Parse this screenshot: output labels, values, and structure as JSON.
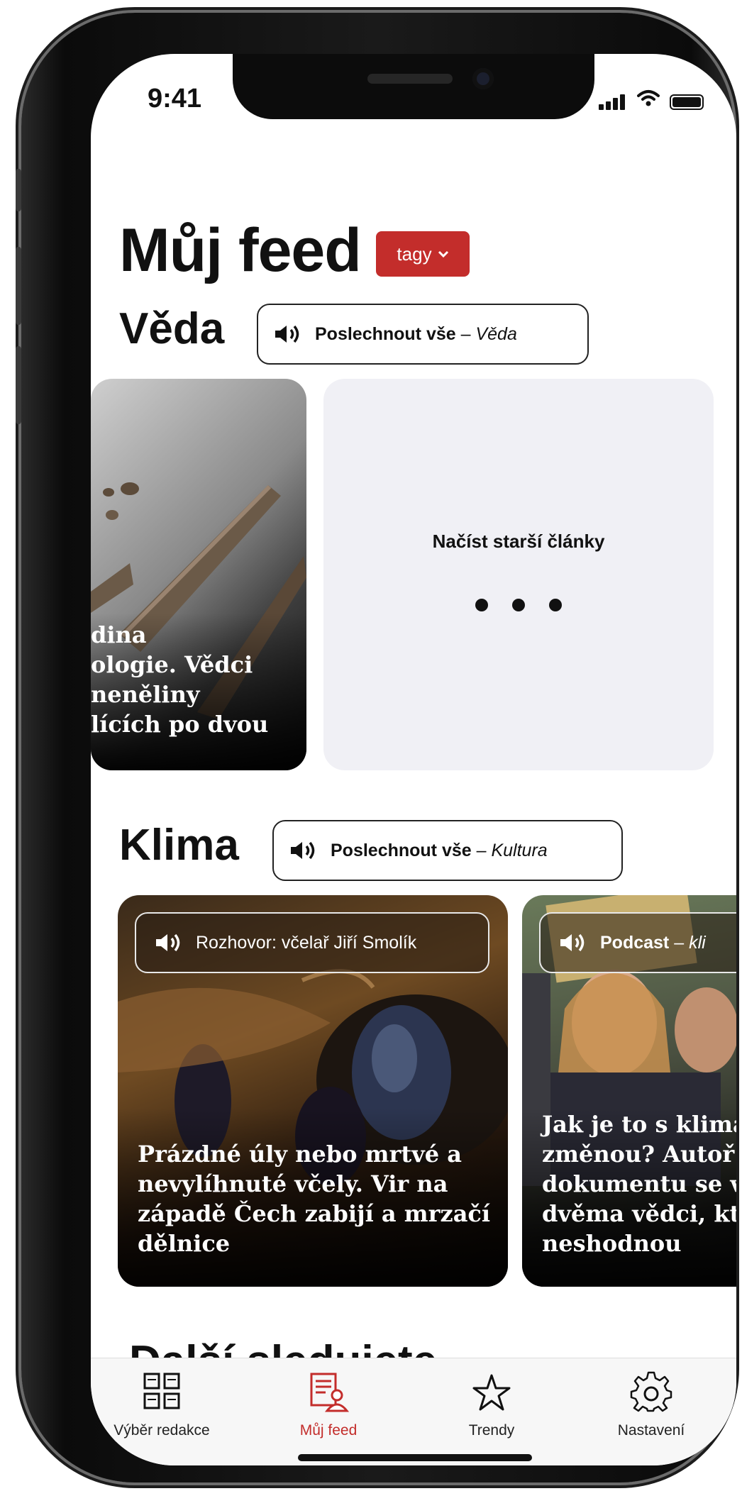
{
  "status_bar": {
    "time": "9:41"
  },
  "header": {
    "title": "Můj feed",
    "tags_button": "tagy"
  },
  "sections": [
    {
      "title": "Věda",
      "listen": {
        "label": "Poslechnout vše",
        "separator": " – ",
        "topic": "Věda"
      },
      "cards": [
        {
          "title_lines": [
            "dina",
            "ologie. Vědci",
            "neněliny",
            "lících po dvou"
          ]
        }
      ],
      "load_more": {
        "label": "Načíst starší články"
      }
    },
    {
      "title": "Klima",
      "listen": {
        "label": "Poslechnout vše",
        "separator": " – ",
        "topic": "Kultura"
      },
      "cards": [
        {
          "audio_label": "Rozhovor: včelař Jiří Smolík",
          "title_lines": [
            "Prázdné úly nebo mrtvé a",
            "nevylíhnuté včely. Vir na",
            "západě Čech zabijí a mrzačí",
            "dělnice"
          ]
        },
        {
          "audio_label": "Podcast",
          "audio_separator": " – ",
          "audio_topic": "kli",
          "title_lines": [
            "Jak je to s klima",
            "změnou? Autoř",
            "dokumentu se v",
            "dvěma vědci, kt",
            "neshodnou"
          ]
        }
      ]
    }
  ],
  "peek_section": {
    "title": "Další sledujete"
  },
  "tabbar": {
    "items": [
      {
        "label": "Výběr redakce",
        "icon": "grid-icon"
      },
      {
        "label": "Můj feed",
        "icon": "feed-user-icon",
        "active": true
      },
      {
        "label": "Trendy",
        "icon": "star-icon"
      },
      {
        "label": "Nastavení",
        "icon": "gear-icon"
      }
    ]
  },
  "colors": {
    "accent": "#c32d2b",
    "card_bg": "#f0f0f5",
    "text": "#111111"
  }
}
